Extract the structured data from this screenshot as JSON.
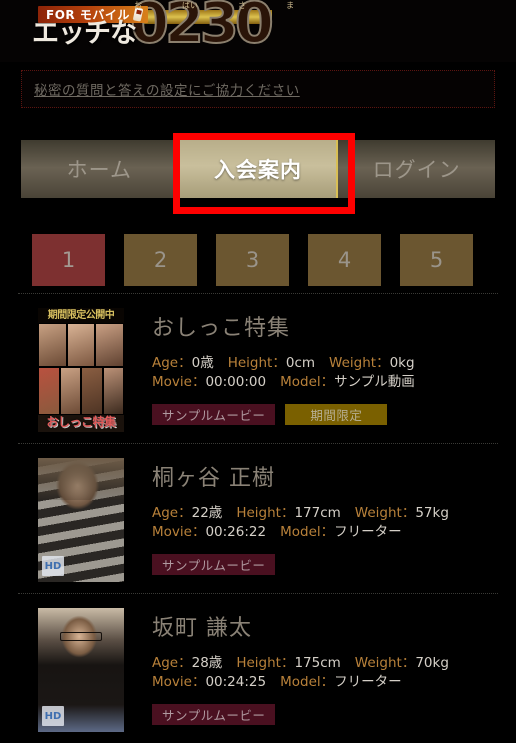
{
  "site": {
    "logo_badge": "FOR モバイル",
    "logo_kana": "エッチな",
    "logo_number": "0230",
    "logo_ruby": [
      "お",
      "ばい",
      "さ",
      "ま"
    ]
  },
  "notice": {
    "link_text": "秘密の質問と答えの設定にご協力ください"
  },
  "tabs": [
    {
      "label": "ホーム",
      "active": false
    },
    {
      "label": "入会案内",
      "active": true
    },
    {
      "label": "ログイン",
      "active": false
    }
  ],
  "annotation": {
    "target": "入会案内",
    "color": "#fe0000"
  },
  "pagination": {
    "pages": [
      {
        "label": "1",
        "active": true
      },
      {
        "label": "2",
        "active": false
      },
      {
        "label": "3",
        "active": false
      },
      {
        "label": "4",
        "active": false
      },
      {
        "label": "5",
        "active": false
      }
    ],
    "active_color": "#7d3030",
    "inactive_color": "#6b5630"
  },
  "labels": {
    "age": "Age",
    "height": "Height",
    "weight": "Weight",
    "movie": "Movie",
    "model": "Model",
    "colon": "：",
    "hd": "HD"
  },
  "items": [
    {
      "title": "おしっこ特集",
      "age": "0歳",
      "height": "0cm",
      "weight": "0kg",
      "movie": "00:00:00",
      "model": "サンプル動画",
      "thumb_header": "期間限定公開中",
      "thumb_footer": "おしっこ特集",
      "badges": [
        {
          "label": "サンプルムービー",
          "style": "sample"
        },
        {
          "label": "期間限定",
          "style": "limited"
        }
      ]
    },
    {
      "title": "桐ヶ谷 正樹",
      "age": "22歳",
      "height": "177cm",
      "weight": "57kg",
      "movie": "00:26:22",
      "model": "フリーター",
      "badges": [
        {
          "label": "サンプルムービー",
          "style": "sample"
        }
      ]
    },
    {
      "title": "坂町 謙太",
      "age": "28歳",
      "height": "175cm",
      "weight": "70kg",
      "movie": "00:24:25",
      "model": "フリーター",
      "badges": [
        {
          "label": "サンプルムービー",
          "style": "sample"
        }
      ]
    }
  ]
}
